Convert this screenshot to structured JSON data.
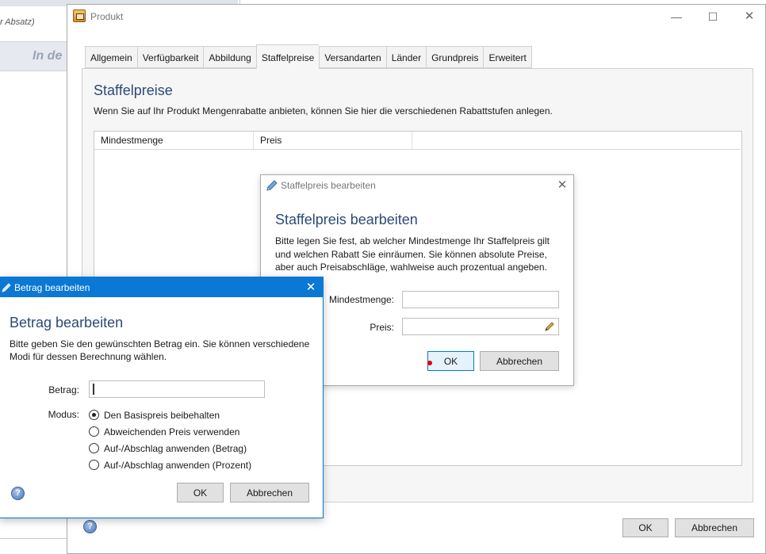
{
  "background": {
    "hint_text": "r Absatz)",
    "band_text": "In de"
  },
  "window": {
    "title": "Produkt",
    "minimize": "—",
    "maximize": "☐",
    "close": "✕",
    "tabs": [
      {
        "label": "Allgemein"
      },
      {
        "label": "Verfügbarkeit"
      },
      {
        "label": "Abbildung"
      },
      {
        "label": "Staffelpreise",
        "active": true
      },
      {
        "label": "Versandarten"
      },
      {
        "label": "Länder"
      },
      {
        "label": "Grundpreis"
      },
      {
        "label": "Erweitert"
      }
    ],
    "heading": "Staffelpreise",
    "description": "Wenn Sie auf Ihr Produkt Mengenrabatte anbieten, können Sie hier die verschiedenen Rabattstufen anlegen.",
    "grid_columns": [
      "Mindestmenge",
      "Preis"
    ],
    "help_glyph": "?",
    "ok_label": "OK",
    "cancel_label": "Abbrechen"
  },
  "staffel_dialog": {
    "title": "Staffelpreis bearbeiten",
    "close": "✕",
    "heading": "Staffelpreis bearbeiten",
    "description": "Bitte legen Sie fest, ab welcher Mindestmenge Ihr Staffelpreis gilt und welchen Rabatt Sie einräumen. Sie können absolute Preise, aber auch Preisabschläge, wahlweise auch prozentual angeben.",
    "label_min": "Mindestmenge:",
    "label_preis": "Preis:",
    "value_min": "",
    "value_preis": "",
    "ok_label": "OK",
    "cancel_label": "Abbrechen"
  },
  "betrag_dialog": {
    "title": "Betrag bearbeiten",
    "close": "✕",
    "heading": "Betrag bearbeiten",
    "description": "Bitte geben Sie den gewünschten Betrag ein. Sie können verschiedene Modi für dessen Berechnung wählen.",
    "label_betrag": "Betrag:",
    "value_betrag": "",
    "label_modus": "Modus:",
    "modes": [
      {
        "label": "Den Basispreis beibehalten",
        "checked": true
      },
      {
        "label": "Abweichenden Preis verwenden",
        "checked": false
      },
      {
        "label": "Auf-/Abschlag anwenden (Betrag)",
        "checked": false
      },
      {
        "label": "Auf-/Abschlag anwenden (Prozent)",
        "checked": false
      }
    ],
    "help_glyph": "?",
    "ok_label": "OK",
    "cancel_label": "Abbrechen"
  }
}
